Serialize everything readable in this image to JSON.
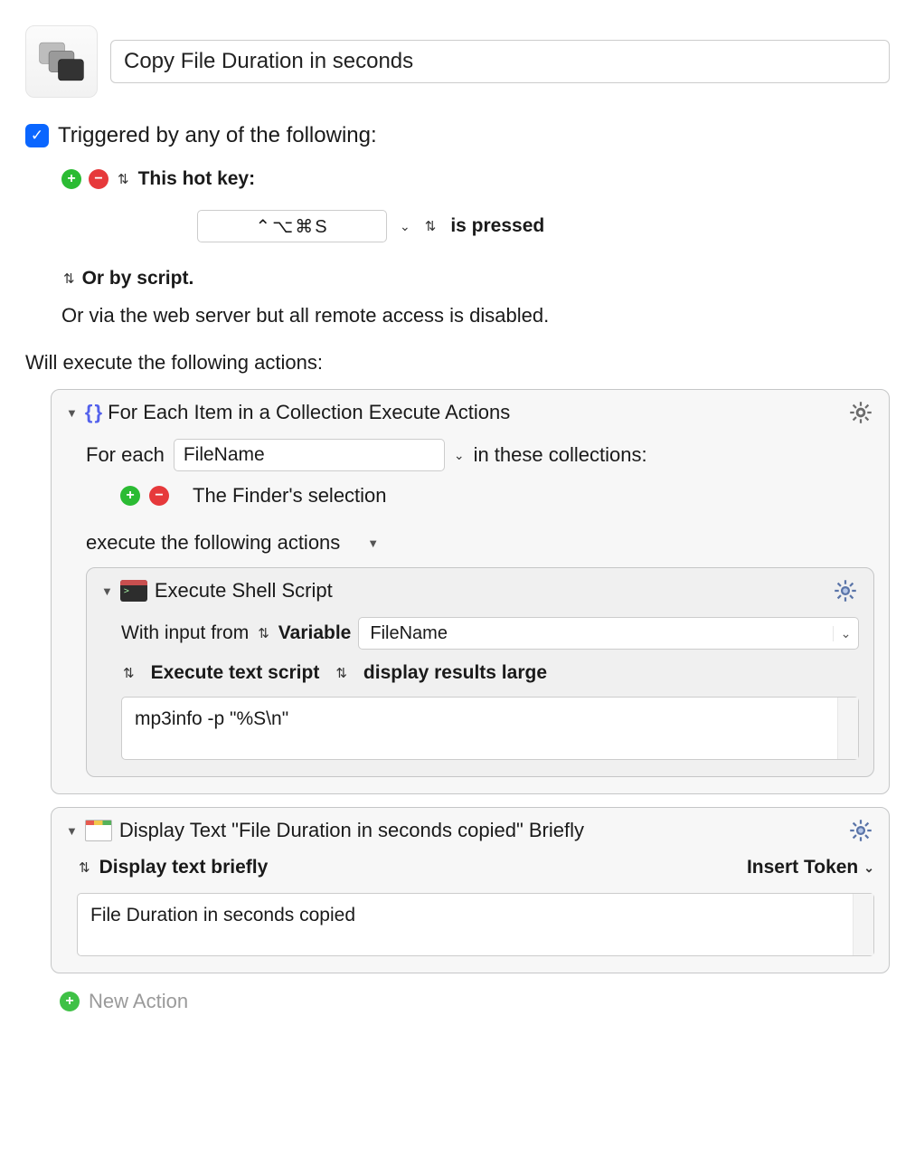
{
  "title": "Copy File Duration in seconds",
  "triggered_checkbox": true,
  "triggered_label": "Triggered by any of the following:",
  "trigger": {
    "hotkey_label": "This hot key:",
    "hotkey_value": "⌃⌥⌘S",
    "state_label": "is pressed",
    "or_script": "Or by script.",
    "remote_note": "Or via the web server but all remote access is disabled."
  },
  "exec_heading": "Will execute the following actions:",
  "foreach": {
    "title": "For Each Item in a Collection Execute Actions",
    "for_each_label": "For each",
    "variable": "FileName",
    "in_label": "in these collections:",
    "collection": "The Finder's selection",
    "subheading": "execute the following actions"
  },
  "shell": {
    "title": "Execute Shell Script",
    "with_input": "With input from",
    "input_type": "Variable",
    "input_var": "FileName",
    "mode": "Execute text script",
    "result": "display results large",
    "script": "mp3info -p \"%S\\n\""
  },
  "display": {
    "title": "Display Text \"File Duration in seconds copied\" Briefly",
    "mode": "Display text briefly",
    "insert_token": "Insert Token",
    "text": "File Duration in seconds copied"
  },
  "new_action": "New Action"
}
